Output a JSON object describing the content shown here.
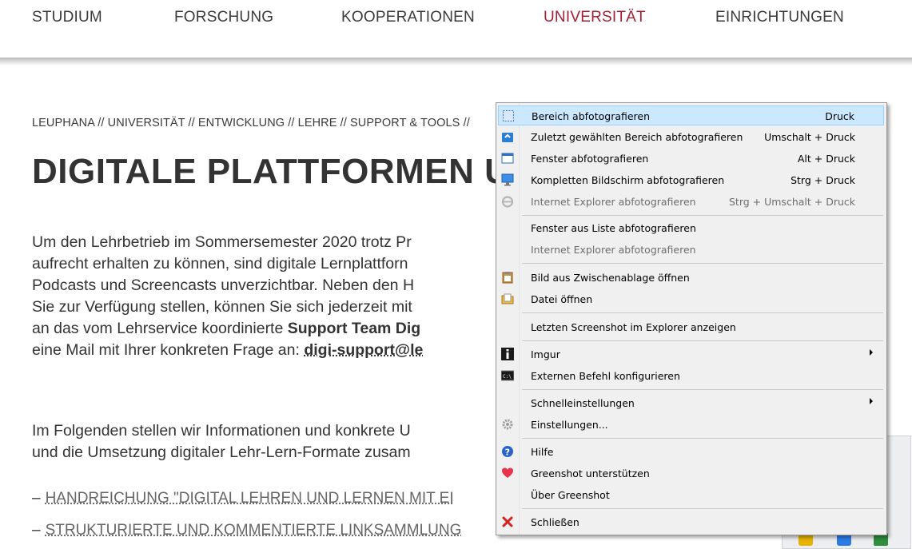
{
  "nav": {
    "items": [
      {
        "label": "STUDIUM"
      },
      {
        "label": "FORSCHUNG"
      },
      {
        "label": "KOOPERATIONEN"
      },
      {
        "label": "UNIVERSITÄT"
      },
      {
        "label": "EINRICHTUNGEN"
      }
    ],
    "active_color": "#a31f34"
  },
  "breadcrumb": "LEUPHANA // UNIVERSITÄT // ENTWICKLUNG // LEHRE // SUPPORT & TOOLS //",
  "page_title": "DIGITALE PLATTFORMEN U",
  "para1": {
    "lines": [
      "Um den Lehrbetrieb im Sommersemester 2020 trotz Pr",
      "aufrecht erhalten zu können, sind digitale Lernplattforn",
      "Podcasts und Screencasts unverzichtbar. Neben den H",
      "Sie zur Verfügung stellen, können Sie sich jederzeit mit",
      "an das vom Lehrservice koordinierte ",
      "eine Mail mit Ihrer konkreten Frage an: "
    ],
    "bold_support": "Support Team Dig",
    "mail": "digi-support@le"
  },
  "para2": {
    "lines": [
      "Im Folgenden stellen wir Informationen und konkrete U",
      "und die Umsetzung digitaler Lehr-Lern-Formate zusam"
    ]
  },
  "links": [
    {
      "dash": "–",
      "label": "HANDREICHUNG \"DIGITAL LEHREN UND LERNEN MIT EI"
    },
    {
      "dash": "–",
      "label": "STRUKTURIERTE UND KOMMENTIERTE LINKSAMMLUNG"
    }
  ],
  "context_menu": {
    "highlight_color": "#cce8ff",
    "items": [
      {
        "label": "Bereich abfotografieren",
        "shortcut": "Druck",
        "icon": "region-capture-icon",
        "highlighted": true
      },
      {
        "label": "Zuletzt gewählten Bereich abfotografieren",
        "shortcut": "Umschalt + Druck",
        "icon": "last-region-icon"
      },
      {
        "label": "Fenster abfotografieren",
        "shortcut": "Alt + Druck",
        "icon": "window-capture-icon"
      },
      {
        "label": "Kompletten Bildschirm abfotografieren",
        "shortcut": "Strg + Druck",
        "icon": "fullscreen-capture-icon"
      },
      {
        "label": "Internet Explorer abfotografieren",
        "shortcut": "Strg + Umschalt + Druck",
        "icon": "ie-icon",
        "disabled": true
      },
      {
        "label": "Fenster aus Liste abfotografieren",
        "shortcut": ""
      },
      {
        "label": "Internet Explorer abfotografieren",
        "shortcut": "",
        "disabled": true
      },
      {
        "label": "Bild aus Zwischenablage öffnen",
        "shortcut": "",
        "icon": "clipboard-icon"
      },
      {
        "label": "Datei öffnen",
        "shortcut": "",
        "icon": "open-file-icon"
      },
      {
        "label": "Letzten Screenshot im Explorer anzeigen",
        "shortcut": ""
      },
      {
        "label": "Imgur",
        "shortcut": "",
        "icon": "imgur-icon",
        "submenu": true
      },
      {
        "label": "Externen Befehl konfigurieren",
        "shortcut": "",
        "icon": "console-icon"
      },
      {
        "label": "Schnelleinstellungen",
        "shortcut": "",
        "submenu": true
      },
      {
        "label": "Einstellungen...",
        "shortcut": "",
        "icon": "settings-gear-icon"
      },
      {
        "label": "Hilfe",
        "shortcut": "",
        "icon": "help-icon"
      },
      {
        "label": "Greenshot unterstützen",
        "shortcut": "",
        "icon": "heart-icon"
      },
      {
        "label": "Über Greenshot",
        "shortcut": ""
      },
      {
        "label": "Schließen",
        "shortcut": "",
        "icon": "close-x-icon"
      }
    ]
  }
}
